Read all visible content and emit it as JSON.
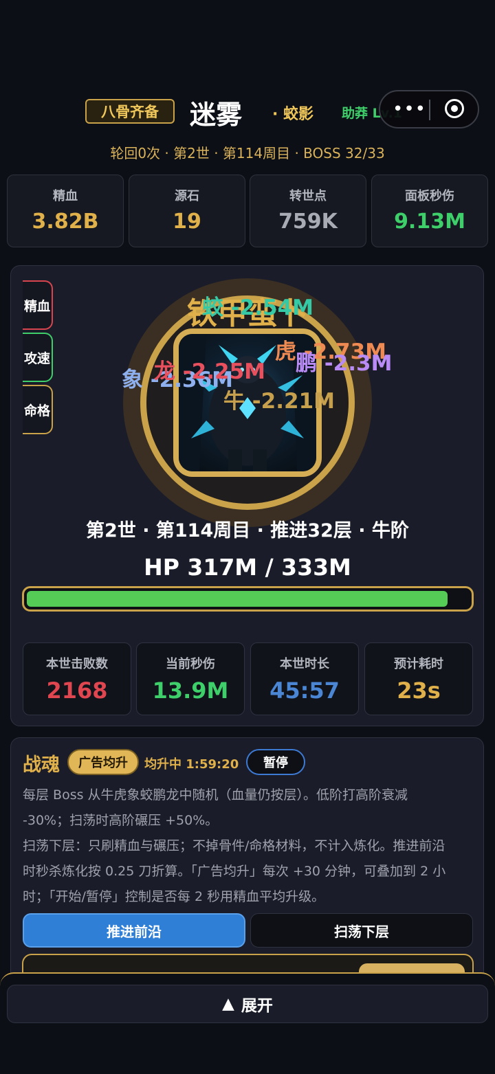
{
  "header": {
    "set_badge": "八骨齐备",
    "realm_name": "迷雾",
    "realm_sub": "· 蛟影",
    "helper": "助莽 Lv.1",
    "capsule_dots": "•••",
    "progress": "轮回0次 · 第2世 · 第114周目 · BOSS 32/33"
  },
  "stats": [
    {
      "label": "精血",
      "value": "3.82B",
      "color": "#e0b04a"
    },
    {
      "label": "源石",
      "value": "19",
      "color": "#e0b04a"
    },
    {
      "label": "转世点",
      "value": "759K",
      "color": "#a9abb4"
    },
    {
      "label": "面板秒伤",
      "value": "9.13M",
      "color": "#3ecf6a"
    }
  ],
  "side_tabs": [
    {
      "label": "精血",
      "color": "#d9454f"
    },
    {
      "label": "攻速",
      "color": "#3ecf6a"
    },
    {
      "label": "命格",
      "color": "#c9a24a"
    }
  ],
  "boss": {
    "name": "铁甲蛮卜",
    "damage_popups": [
      {
        "text": "蛟 -2.54M",
        "color": "#35c9a5"
      },
      {
        "text": "虎 -2.73M",
        "color": "#ef8a52"
      },
      {
        "text": "鹏 -2.3M",
        "color": "#b98bf4"
      },
      {
        "text": "象 -2.36M",
        "color": "#8eb0ee"
      },
      {
        "text": "龙 -2.25M",
        "color": "#e8505e"
      },
      {
        "text": "牛 -2.21M",
        "color": "#c7a04e"
      }
    ],
    "info_line": "第2世 · 第114周目 · 推进32层 · 牛阶",
    "hp_text": "HP 317M / 333M",
    "hp_fraction": 0.952
  },
  "session_stats": [
    {
      "label": "本世击败数",
      "value": "2168",
      "color": "#e0464f"
    },
    {
      "label": "当前秒伤",
      "value": "13.9M",
      "color": "#3ecf6a"
    },
    {
      "label": "本世时长",
      "value": "45:57",
      "color": "#4a86d4"
    },
    {
      "label": "预计耗时",
      "value": "23s",
      "color": "#e0b04a"
    }
  ],
  "soul": {
    "title": "战魂",
    "ad_button": "广告均升",
    "timer": "均升中 1:59:20",
    "pause_button": "暂停",
    "desc_lines": [
      "每层 Boss 从牛虎象蛟鹏龙中随机（血量仍按层）。低阶打高阶衰减",
      "-30%；扫荡时高阶碾压 +50%。",
      "扫荡下层：只刷精血与碾压；不掉骨件/命格材料，不计入炼化。推进前沿",
      "时秒杀炼化按 0.25 刀折算。「广告均升」每次 +30 分钟，可叠加到 2 小",
      "时；「开始/暂停」控制是否每 2 秒用精血平均升级。"
    ],
    "tab_advance": "推进前沿",
    "tab_sweep": "扫荡下层"
  },
  "footer": {
    "expand_arrow": "▲",
    "expand_label": "展开"
  }
}
